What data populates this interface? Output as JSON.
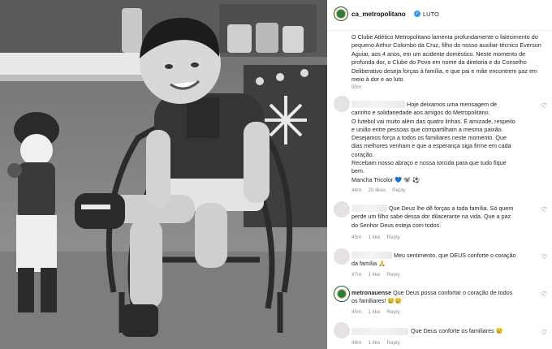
{
  "post": {
    "username": "ca_metropolitano",
    "verified_mark": "✓",
    "tag": "LUTO",
    "caption": "O Clube Atlético Metropolitano lamenta profundamente o falecimento do pequeno Arthur Colombo da Cruz, filho do nosso auxiliar-técnico Everson Aguiar, aos 4 anos, em um acidente doméstico. Neste momento de profunda dor, o Clube do Povo em nome da diretoria e do Conselho Deliberativo deseja forças à família, e que pai e mãe encontrem paz em meio à dor e ao luto.",
    "time": "50m"
  },
  "comments": [
    {
      "username": "",
      "text_lines": [
        "Hoje deixamos uma mensagem de",
        "carinho e solidariedade aos amigos do Metropolitano.",
        "O futebol vai muito além das quatro linhas. É amizade, respeito",
        "e união entre pessoas que compartilham a mesma paixão.",
        "Desejamos força a todos os familiares neste momento. Que",
        "dias melhores venham e que a esperança siga firme em cada",
        "coração.",
        "Recebam nosso abraço e nossa torcida para que tudo fique",
        "bem.",
        "Mancha Tricolor 💙 🐨 ⚽"
      ],
      "time": "44m",
      "likes": "20 likes",
      "reply": "Reply"
    },
    {
      "username": "",
      "text_lines": [
        "Que Deus lhe dê forças a toda família. Só quem",
        "perde um filho sabe dessa dor dilacerante na vida. Que a paz",
        "do Senhor Deus esteja com todos."
      ],
      "time": "45m",
      "likes": "1 like",
      "reply": "Reply"
    },
    {
      "username": "",
      "text_lines": [
        "Meu sentimento, que DEUS conforte o coração",
        "da família 🙏"
      ],
      "time": "47m",
      "likes": "1 like",
      "reply": "Reply"
    },
    {
      "username": "metronauense",
      "text_lines": [
        "Que Deus possa confortar o coração de todos",
        "os familiares! 😢😢"
      ],
      "time": "45m",
      "likes": "1 like",
      "reply": "Reply"
    },
    {
      "username": "",
      "text_lines": [
        "Que Deus conforte os familiares 😢"
      ],
      "time": "48m",
      "likes": "1 like",
      "reply": "Reply"
    }
  ],
  "icons": {
    "heart": "♡",
    "verified": "verified-badge-icon",
    "avatar": "club-crest-icon"
  },
  "colors": {
    "verified_blue": "#2f9bf3",
    "club_green": "#2f7a45",
    "meta_gray": "#8e8e8e"
  }
}
